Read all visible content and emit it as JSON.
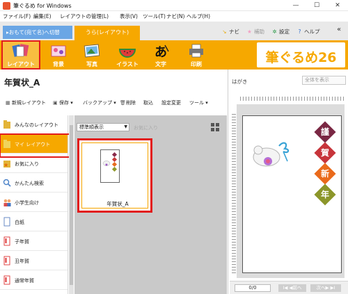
{
  "window": {
    "title": "筆ぐるめ for Windows",
    "minimize": "—",
    "maximize": "☐",
    "close": "✕"
  },
  "menu": [
    "ファイル(F)",
    "編集(E)",
    "レイアウトの管理(L)",
    "表示(V)",
    "ツール(T)",
    "ナビ(N)",
    "ヘルプ(H)"
  ],
  "tabs": {
    "switch": "▸おもて(宛て名)へ切替",
    "ura": "うら(レイアウト)"
  },
  "tools": {
    "navi": "ナビ",
    "assist": "補助",
    "settings": "設定",
    "help": "ヘルプ",
    "expand": "«"
  },
  "mainbar": {
    "buttons": [
      "レイアウト",
      "背景",
      "写真",
      "イラスト",
      "文字",
      "印刷"
    ],
    "brand": "筆ぐるめ26"
  },
  "panel": {
    "title": "年賀状_A"
  },
  "toolbar": {
    "new": "新規レイアウト",
    "save": "保存",
    "backup": "バックアップ",
    "delete": "削除",
    "import": "取込",
    "change_settings": "設定変更",
    "tools": "ツール"
  },
  "sidebar": {
    "items": [
      "みんなのレイアウト",
      "マイ レイアウト",
      "お気に入り",
      "かんたん検索",
      "小学生向け",
      "白紙",
      "子年賀",
      "丑年賀",
      "通常年賀"
    ]
  },
  "list": {
    "sort": "標準順表示",
    "favorite": "お気に入り",
    "item_label": "年賀状_A"
  },
  "preview": {
    "label": "はがき",
    "view_select": "全体を表示",
    "chars": [
      "謹",
      "賀",
      "新",
      "年"
    ],
    "page": "0/0",
    "prev": "I◀ ◀前へ",
    "next": "次へ▶ ▶I"
  }
}
